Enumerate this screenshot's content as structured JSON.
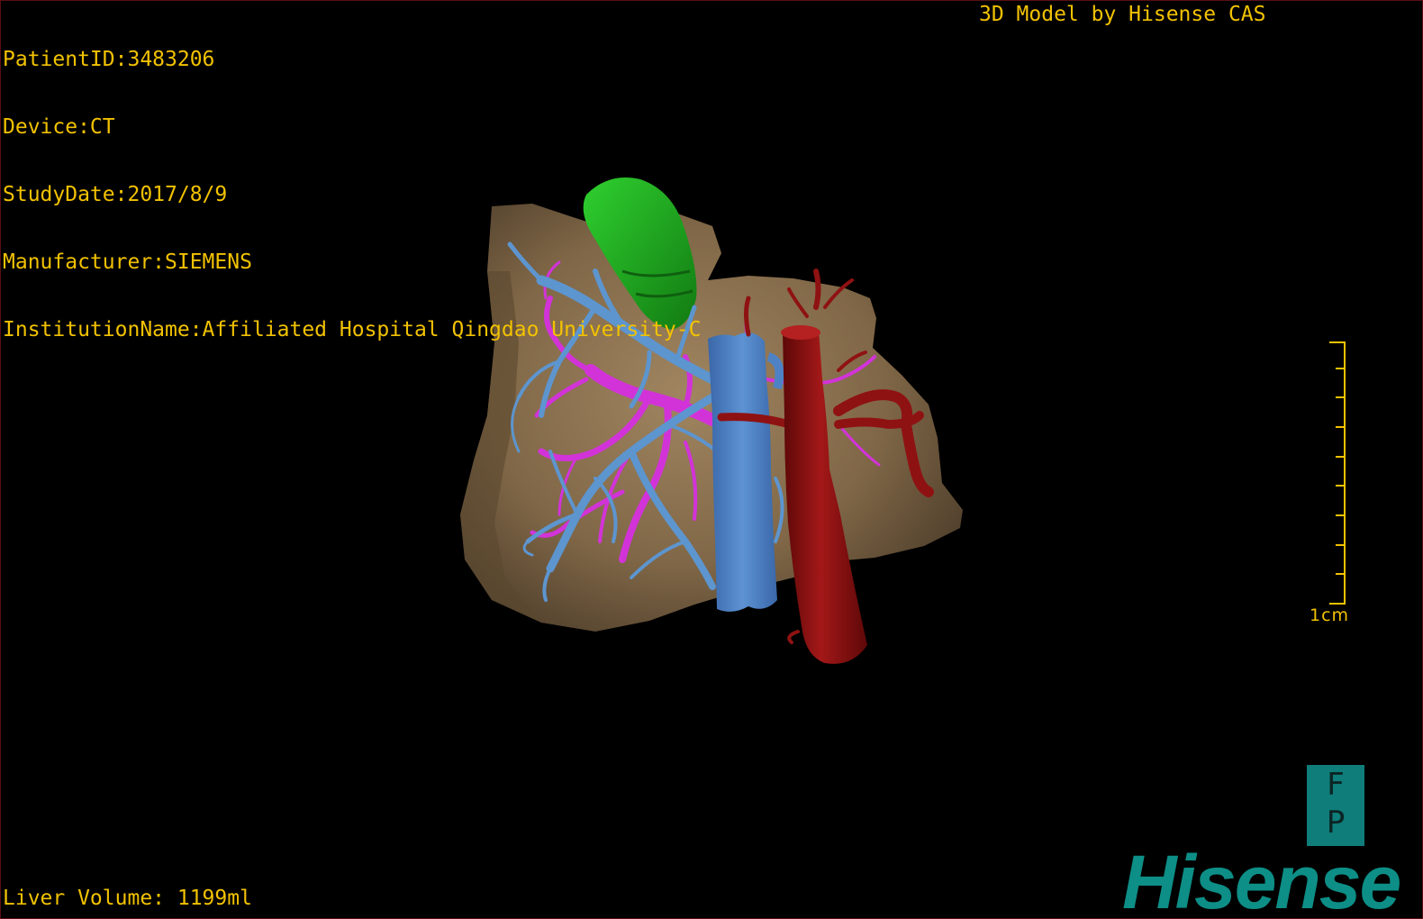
{
  "info": {
    "patient_id": "PatientID:3483206",
    "device": "Device:CT",
    "study_date": "StudyDate:2017/8/9",
    "manufacturer": "Manufacturer:SIEMENS",
    "institution": "InstitutionName:Affiliated Hospital Qingdao University-C"
  },
  "brand_label": "3D Model by Hisense CAS",
  "liver_volume": "Liver Volume: 1199ml",
  "scale_bar": {
    "label": "1cm"
  },
  "orientation": {
    "top": "F",
    "bottom": "P"
  },
  "logo_text": "Hisense",
  "colors": {
    "overlay_text": "#f2c200",
    "liver": "#8b7150",
    "gallbladder": "#1fa81f",
    "hepatic_vein": "#5d95cf",
    "portal_vein": "#d233d8",
    "aorta": "#8f1212",
    "vena_cava": "#4f82c4",
    "logo": "#0d8e86"
  }
}
